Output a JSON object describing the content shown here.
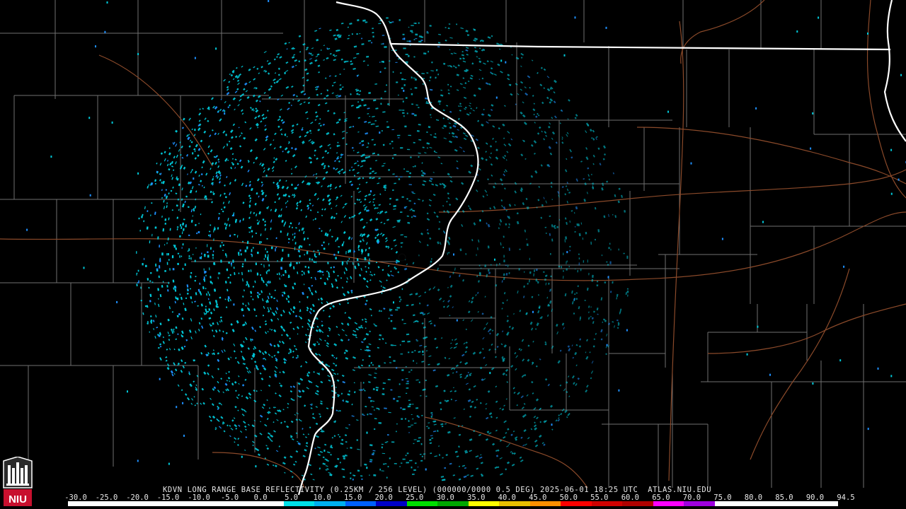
{
  "product": {
    "caption": "KDVN LONG RANGE BASE REFLECTIVITY (0.25KM / 256 LEVEL) (000000/0000 0.5 DEG) 2025-06-01 18:25 UTC  ATLAS.NIU.EDU",
    "logo_text": "NIU"
  },
  "legend": {
    "labels": [
      "-30.0",
      "-25.0",
      "-20.0",
      "-15.0",
      "-10.0",
      "-5.0",
      "0.0",
      "5.0",
      "10.0",
      "15.0",
      "20.0",
      "25.0",
      "30.0",
      "35.0",
      "40.0",
      "45.0",
      "50.0",
      "55.0",
      "60.0",
      "65.0",
      "70.0",
      "75.0",
      "80.0",
      "85.0",
      "90.0",
      "94.5"
    ],
    "colors": [
      "#ffffff",
      "#ffffff",
      "#ffffff",
      "#ffffff",
      "#ffffff",
      "#ffffff",
      "#ffffff",
      "#00e0e8",
      "#00b0f0",
      "#0060ff",
      "#0000c8",
      "#00e000",
      "#00a800",
      "#ffff00",
      "#e8c000",
      "#ff9000",
      "#ff0000",
      "#d00000",
      "#b00000",
      "#ff00ff",
      "#a000e0",
      "#ffffff",
      "#ffffff",
      "#ffffff",
      "#ffffff"
    ]
  },
  "colors": {
    "background": "#000000",
    "county_lines": "#707070",
    "state_lines": "#ffffff",
    "highways": "#8b4a2a",
    "echo_primary": "#00c8d8",
    "echo_secondary": "#1e90ff"
  },
  "radar_site": "KDVN"
}
